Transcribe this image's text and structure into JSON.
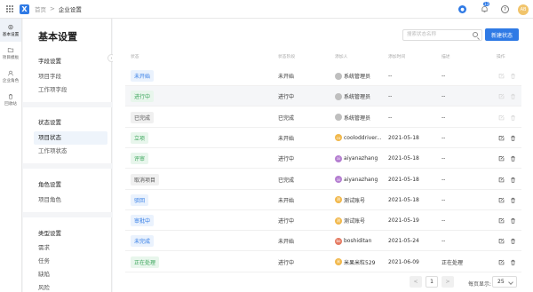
{
  "topbar": {
    "breadcrumb_home": "首页",
    "breadcrumb_sep": ">",
    "breadcrumb_current": "企业设置",
    "notif_count": "13",
    "help": "?",
    "user_initials": "AB",
    "logo_glyph": "X",
    "dot_glyph": "●"
  },
  "rail": {
    "items": [
      {
        "label": "基本设置",
        "icon": "gear-icon"
      },
      {
        "label": "项目模板",
        "icon": "folder-icon"
      },
      {
        "label": "企业角色",
        "icon": "user-icon"
      },
      {
        "label": "回收站",
        "icon": "trash-icon"
      }
    ]
  },
  "panel": {
    "title": "基本设置",
    "groups": [
      {
        "title": "字段设置",
        "items": [
          "项目字段",
          "工作项字段"
        ]
      },
      {
        "title": "状态设置",
        "items": [
          "项目状态",
          "工作项状态"
        ]
      },
      {
        "title": "角色设置",
        "items": [
          "项目角色"
        ]
      },
      {
        "title": "类型设置",
        "items": [
          "需求",
          "任务",
          "缺陷",
          "风险"
        ]
      }
    ]
  },
  "main": {
    "search_placeholder": "搜索状态名称",
    "new_button": "新建状态",
    "columns": [
      "状态",
      "状态阶段",
      "添加人",
      "添加时间",
      "描述",
      "操作"
    ],
    "rows": [
      {
        "status": "未开始",
        "stage": "未开始",
        "adder": "系统管理员",
        "time": "--",
        "desc": "--",
        "tag_color": "#2f7ae5",
        "tag_bg": "#eaf2fd",
        "av_color": "#bfbfbf",
        "av_text": "",
        "hl": false,
        "ops_disabled": true
      },
      {
        "status": "进行中",
        "stage": "进行中",
        "adder": "系统管理员",
        "time": "--",
        "desc": "--",
        "tag_color": "#3aa55a",
        "tag_bg": "#e8f6ec",
        "av_color": "#bfbfbf",
        "av_text": "",
        "hl": true,
        "ops_disabled": true
      },
      {
        "status": "已完成",
        "stage": "已完成",
        "adder": "系统管理员",
        "time": "--",
        "desc": "--",
        "tag_color": "#555555",
        "tag_bg": "#f0f0f0",
        "av_color": "#bfbfbf",
        "av_text": "",
        "hl": false,
        "ops_disabled": true
      },
      {
        "status": "立项",
        "stage": "未开始",
        "adder": "cooloddriver...",
        "time": "2021-05-18",
        "desc": "--",
        "tag_color": "#3aa55a",
        "tag_bg": "#e8f6ec",
        "av_color": "#f1b84b",
        "av_text": "co",
        "hl": false,
        "ops_disabled": false
      },
      {
        "status": "评审",
        "stage": "进行中",
        "adder": "aiyanazhang",
        "time": "2021-05-18",
        "desc": "--",
        "tag_color": "#3aa55a",
        "tag_bg": "#e8f6ec",
        "av_color": "#b57fd1",
        "av_text": "ai",
        "hl": false,
        "ops_disabled": false
      },
      {
        "status": "取消项目",
        "stage": "已完成",
        "adder": "aiyanazhang",
        "time": "2021-05-18",
        "desc": "--",
        "tag_color": "#555555",
        "tag_bg": "#f0f0f0",
        "av_color": "#b57fd1",
        "av_text": "ai",
        "hl": false,
        "ops_disabled": false
      },
      {
        "status": "驳回",
        "stage": "未开始",
        "adder": "测试账号",
        "time": "2021-05-18",
        "desc": "--",
        "tag_color": "#2f7ae5",
        "tag_bg": "#eaf2fd",
        "av_color": "#f1b84b",
        "av_text": "测",
        "hl": false,
        "ops_disabled": false
      },
      {
        "status": "审批中",
        "stage": "进行中",
        "adder": "测试账号",
        "time": "2021-05-19",
        "desc": "--",
        "tag_color": "#2f7ae5",
        "tag_bg": "#eaf2fd",
        "av_color": "#f1b84b",
        "av_text": "测",
        "hl": false,
        "ops_disabled": false
      },
      {
        "status": "未完成",
        "stage": "未开始",
        "adder": "boshiditan",
        "time": "2021-05-24",
        "desc": "--",
        "tag_color": "#2f7ae5",
        "tag_bg": "#eaf2fd",
        "av_color": "#e57a62",
        "av_text": "bo",
        "hl": false,
        "ops_disabled": false
      },
      {
        "status": "正在处理",
        "stage": "进行中",
        "adder": "米果米粒529",
        "time": "2021-06-09",
        "desc": "正在处理",
        "tag_color": "#3aa55a",
        "tag_bg": "#e8f6ec",
        "av_color": "#f1b84b",
        "av_text": "米",
        "hl": false,
        "ops_disabled": false
      }
    ],
    "pager": {
      "prev": "<",
      "page": "1",
      "next": ">",
      "size_label": "每页显示:",
      "size_value": "25"
    }
  }
}
